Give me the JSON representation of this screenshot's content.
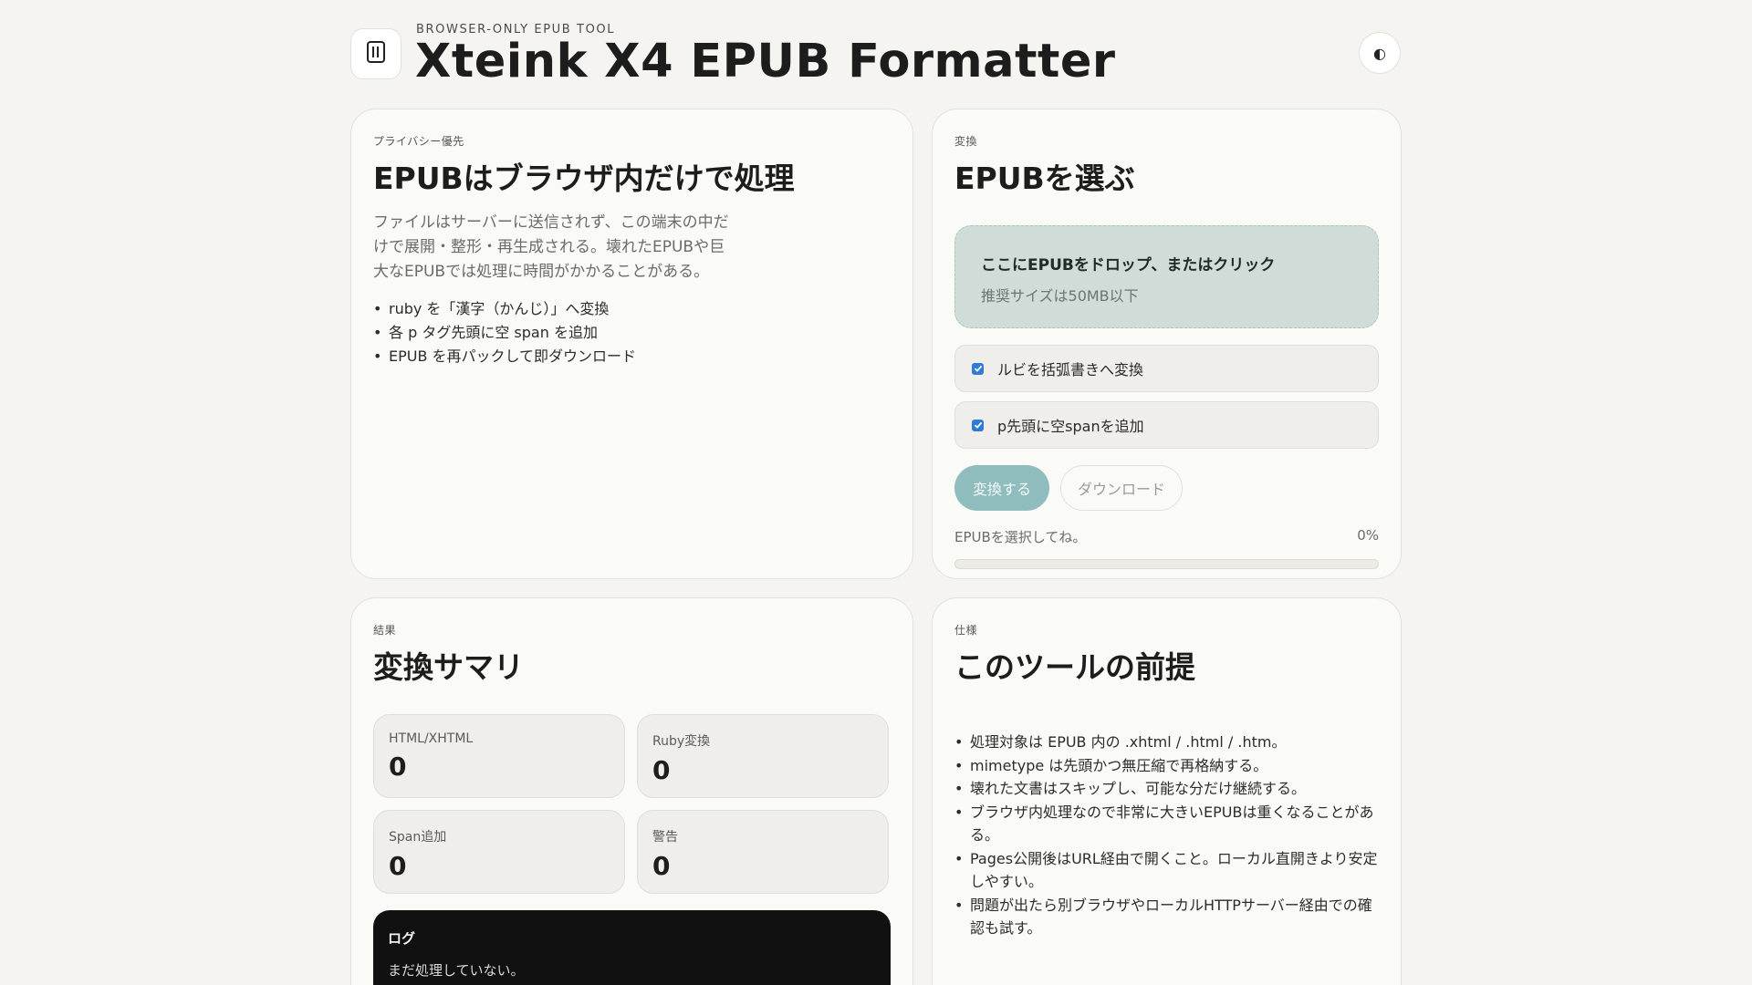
{
  "header": {
    "eyebrow": "BROWSER-ONLY EPUB TOOL",
    "title": "Xteink X4 EPUB Formatter",
    "logo_icon": "book-icon",
    "theme_toggle_symbol": "◐"
  },
  "privacy": {
    "eyebrow": "プライバシー優先",
    "title": "EPUBはブラウザ内だけで処理",
    "description": "ファイルはサーバーに送信されず、この端末の中だけで展開・整形・再生成される。壊れたEPUBや巨大なEPUBでは処理に時間がかかることがある。",
    "bullets": [
      "ruby を「漢字（かんじ）」へ変換",
      "各 p タグ先頭に空 span を追加",
      "EPUB を再パックして即ダウンロード"
    ]
  },
  "convert": {
    "eyebrow": "変換",
    "title": "EPUBを選ぶ",
    "dropzone_main": "ここにEPUBをドロップ、またはクリック",
    "dropzone_sub": "推奨サイズは50MB以下",
    "options": [
      {
        "label": "ルビを括弧書きへ変換",
        "checked": true
      },
      {
        "label": "p先頭に空spanを追加",
        "checked": true
      }
    ],
    "convert_button": "変換する",
    "download_button": "ダウンロード",
    "status_text": "EPUBを選択してね。",
    "progress_text": "0%",
    "progress_value": 0,
    "accent_color": "#8fbdbd"
  },
  "summary": {
    "eyebrow": "結果",
    "title": "変換サマリ",
    "stats": [
      {
        "label": "HTML/XHTML",
        "value": "0"
      },
      {
        "label": "Ruby変換",
        "value": "0"
      },
      {
        "label": "Span追加",
        "value": "0"
      },
      {
        "label": "警告",
        "value": "0"
      }
    ],
    "log_title": "ログ",
    "log_text": "まだ処理していない。"
  },
  "spec": {
    "eyebrow": "仕様",
    "title": "このツールの前提",
    "items": [
      "処理対象は EPUB 内の .xhtml / .html / .htm。",
      "mimetype は先頭かつ無圧縮で再格納する。",
      "壊れた文書はスキップし、可能な分だけ継続する。",
      "ブラウザ内処理なので非常に大きいEPUBは重くなることがある。",
      "Pages公開後はURL経由で開くこと。ローカル直開きより安定しやすい。",
      "問題が出たら別ブラウザやローカルHTTPサーバー経由での確認も試す。"
    ]
  }
}
